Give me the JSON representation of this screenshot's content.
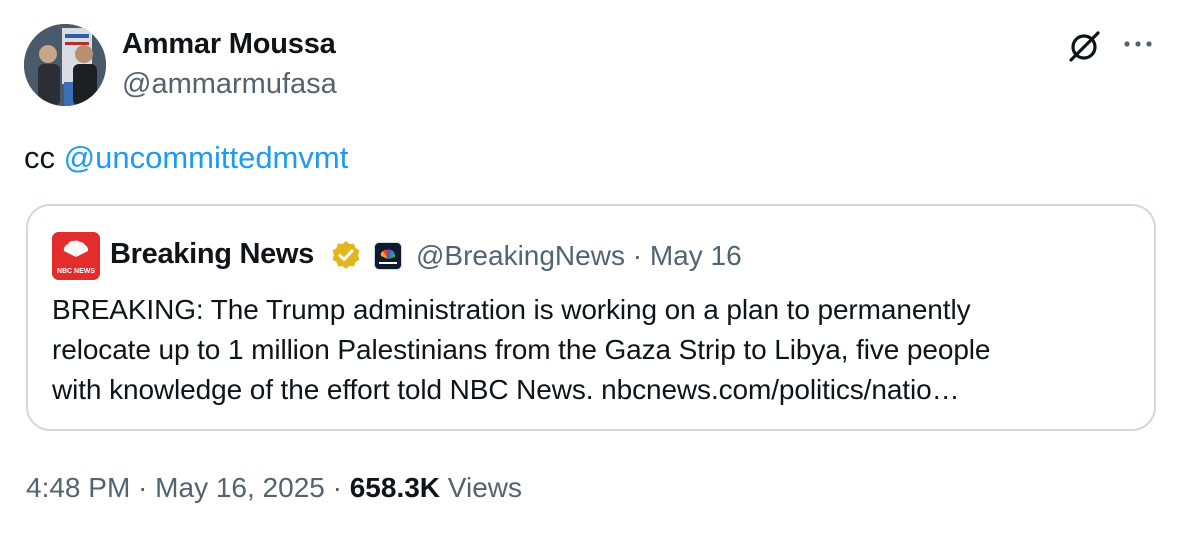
{
  "author": {
    "display_name": "Ammar Moussa",
    "handle": "@ammarmufasa"
  },
  "tweet": {
    "text_prefix": "cc ",
    "mention": "@uncommittedmvmt"
  },
  "quoted_tweet": {
    "display_name": "Breaking News",
    "handle": "@BreakingNews",
    "separator": " · ",
    "date": "May 16",
    "avatar_label": "NBC NEWS",
    "text_lines": [
      "BREAKING: The Trump administration is working on a plan to permanently",
      "relocate up to 1 million Palestinians from the Gaza Strip to Libya, five people",
      "with knowledge of the effort told NBC News. nbcnews.com/politics/natio…"
    ]
  },
  "meta": {
    "time": "4:48 PM",
    "sep1": " · ",
    "date": "May 16, 2025",
    "sep2": " · ",
    "views_count": "658.3K",
    "views_label": " Views"
  },
  "icons": {
    "grok": "grok-icon",
    "more": "more-dots-icon",
    "verified": "verified-badge-icon",
    "affiliate": "nbc-peacock-icon"
  },
  "colors": {
    "link": "#1d9bf0",
    "secondary_text": "#536471",
    "border": "#cfd9de",
    "verified_gold": "#e2b719",
    "nbc_red": "#e32d2d"
  }
}
